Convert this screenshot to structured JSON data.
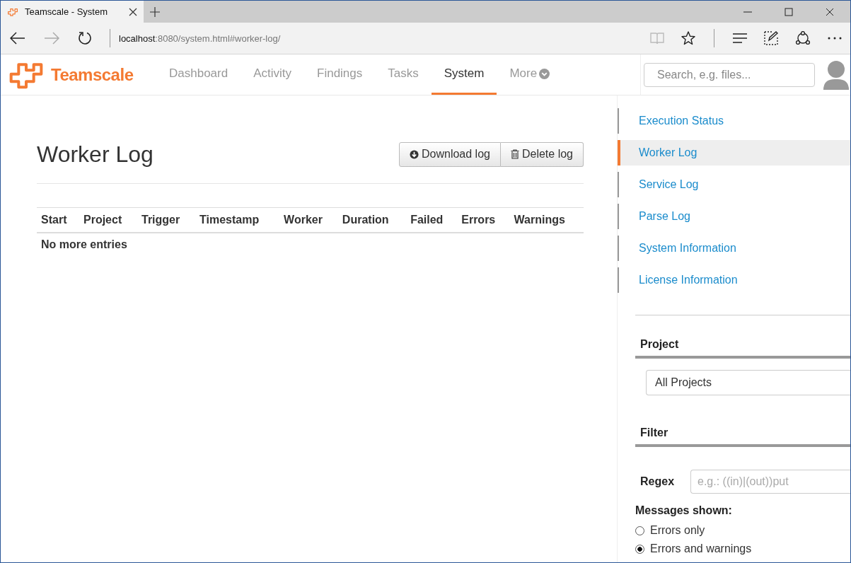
{
  "browser": {
    "tab": {
      "title": "Teamscale - System"
    },
    "address": {
      "host": "localhost",
      "path": ":8080/system.html#worker-log/"
    }
  },
  "app": {
    "logo": "Teamscale",
    "nav": [
      {
        "label": "Dashboard",
        "selected": false,
        "kind": "link"
      },
      {
        "label": "Activity",
        "selected": false,
        "kind": "link"
      },
      {
        "label": "Findings",
        "selected": false,
        "kind": "link"
      },
      {
        "label": "Tasks",
        "selected": false,
        "kind": "link"
      },
      {
        "label": "System",
        "selected": true,
        "kind": "link"
      },
      {
        "label": "More",
        "selected": false,
        "kind": "menu"
      }
    ],
    "search": {
      "placeholder": "Search, e.g. files..."
    }
  },
  "page": {
    "title": "Worker Log",
    "buttons": [
      {
        "label": "Download log",
        "kind": "download"
      },
      {
        "label": "Delete log",
        "kind": "delete"
      }
    ],
    "table": {
      "columns": [
        "Start",
        "Project",
        "Trigger",
        "Timestamp",
        "Worker",
        "Duration",
        "Failed",
        "Errors",
        "Warnings"
      ],
      "empty_message": "No more entries"
    }
  },
  "sidebar": {
    "items": [
      {
        "label": "Execution Status",
        "selected": false
      },
      {
        "label": "Worker Log",
        "selected": true
      },
      {
        "label": "Service Log",
        "selected": false
      },
      {
        "label": "Parse Log",
        "selected": false
      },
      {
        "label": "System Information",
        "selected": false
      },
      {
        "label": "License Information",
        "selected": false
      }
    ],
    "project": {
      "heading": "Project",
      "value": "All Projects"
    },
    "filter": {
      "heading": "Filter",
      "regex_label": "Regex",
      "regex_placeholder": "e.g.: ((in)|(out))put",
      "messages_label": "Messages shown:",
      "options": [
        {
          "label": "Errors only",
          "selected": false
        },
        {
          "label": "Errors and warnings",
          "selected": true
        }
      ]
    }
  }
}
